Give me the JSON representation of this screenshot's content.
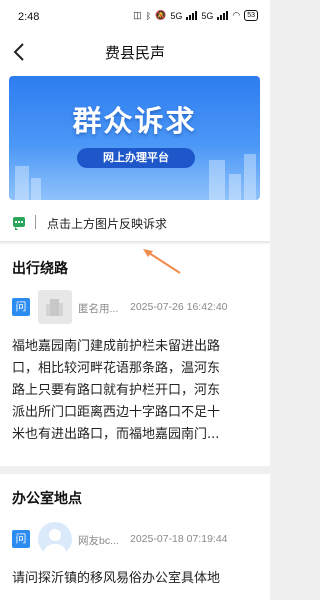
{
  "status_bar": {
    "time": "2:48",
    "network_1": "5G",
    "network_2": "5G",
    "battery": "53"
  },
  "nav": {
    "title": "费县民声"
  },
  "banner": {
    "title": "群众诉求",
    "subtitle": "网上办理平台"
  },
  "tip": {
    "text": "点击上方图片反映诉求"
  },
  "posts": [
    {
      "title": "出行绕路",
      "tag": "问",
      "author": "匿名用...",
      "datetime": "2025-07-26 16:42:40",
      "lines": [
        "福地嘉园南门建成前护栏未留进出路",
        "口，相比较河畔花语那条路，温河东",
        "路上只要有路口就有护栏开口，河东",
        "派出所门口距离西边十字路口不足十",
        "米也有进出路口，而福地嘉园南门..."
      ]
    },
    {
      "title": "办公室地点",
      "tag": "问",
      "author": "网友bc...",
      "datetime": "2025-07-18 07:19:44",
      "lines": [
        "请问探沂镇的移风易俗办公室具体地"
      ]
    }
  ],
  "colors": {
    "accent": "#2d8cf0",
    "tip_icon": "#2aa55a",
    "arrow": "#f08a4b"
  }
}
